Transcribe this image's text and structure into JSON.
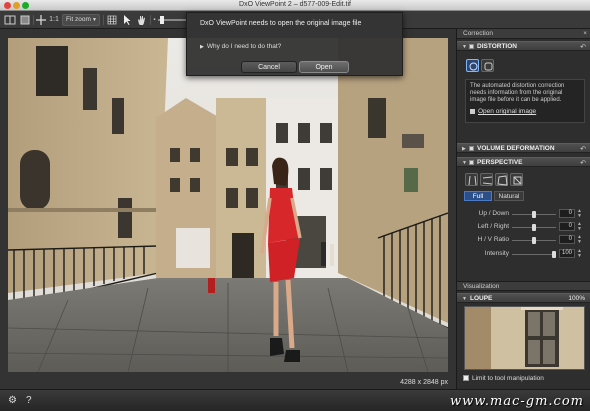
{
  "window": {
    "title": "DxO ViewPoint 2 – d577-009-Edit.tif"
  },
  "toolbar": {
    "zoom_1to1": "1:1",
    "zoom_mode": "Fit zoom"
  },
  "dialog": {
    "message": "DxO ViewPoint needs to open the original image file",
    "disclosure": "Why do I need to do that?",
    "cancel_label": "Cancel",
    "open_label": "Open"
  },
  "viewer": {
    "resolution": "4288 x 2848 px"
  },
  "panel": {
    "tab_label": "Correction",
    "distortion": {
      "title": "DISTORTION",
      "info_text": "The automated distortion correction needs information from the original image file before it can be applied.",
      "open_link": "Open original image"
    },
    "volume": {
      "title": "VOLUME DEFORMATION"
    },
    "perspective": {
      "title": "PERSPECTIVE",
      "mode_full": "Full",
      "mode_natural": "Natural",
      "sliders": [
        {
          "label": "Up / Down",
          "value": "0"
        },
        {
          "label": "Left / Right",
          "value": "0"
        },
        {
          "label": "H / V Ratio",
          "value": "0"
        },
        {
          "label": "Intensity",
          "value": "100"
        }
      ]
    },
    "visualization_label": "Visualization",
    "loupe": {
      "title": "LOUPE",
      "zoom": "100%"
    },
    "limit_label": "Limit to tool manipulation"
  },
  "watermark": "www.mac-gm.com",
  "colors": {
    "accent": "#2c4f8a",
    "dress": "#d7272b"
  }
}
